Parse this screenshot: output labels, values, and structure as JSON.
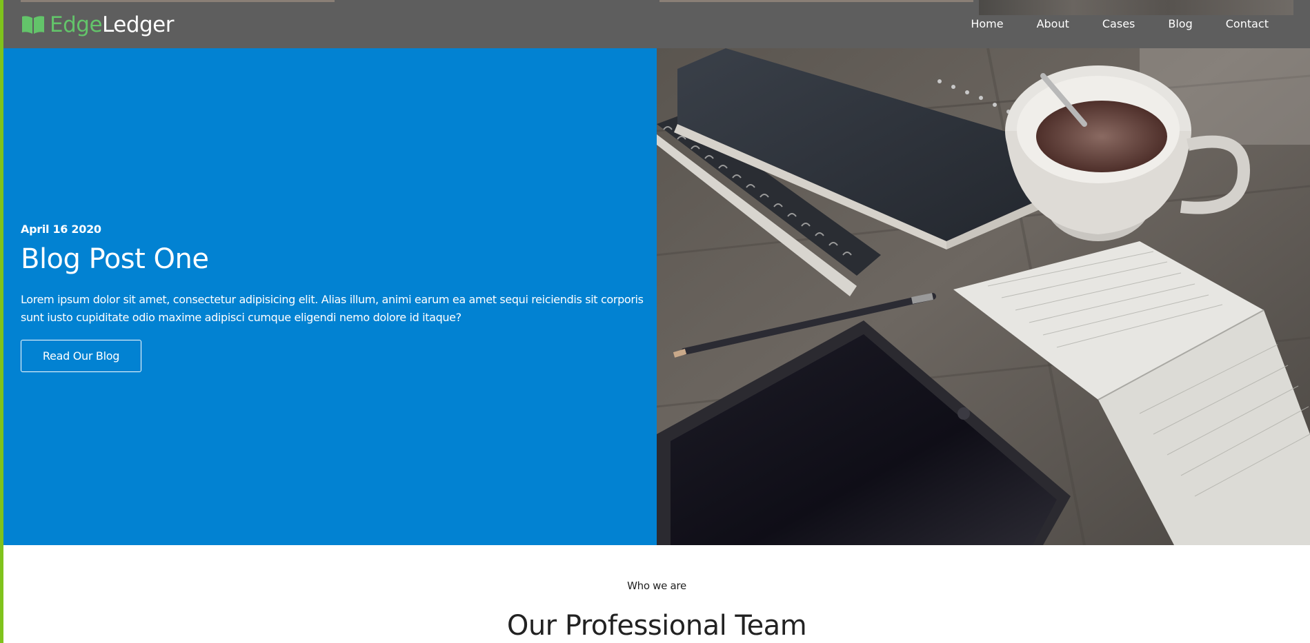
{
  "header": {
    "logo": {
      "part1": "Edge",
      "part2": "Ledger",
      "icon": "open-book-icon",
      "part1_color": "#63c46a",
      "part2_color": "#ffffff"
    },
    "nav": [
      {
        "label": "Home"
      },
      {
        "label": "About"
      },
      {
        "label": "Cases"
      },
      {
        "label": "Blog"
      },
      {
        "label": "Contact"
      }
    ],
    "background_color": "#5e5e5e"
  },
  "hero": {
    "date": "April 16 2020",
    "title": "Blog Post One",
    "body": "Lorem ipsum dolor sit amet, consectetur adipisicing elit. Alias illum, animi earum ea amet sequi reiciendis sit corporis sunt iusto cupiditate odio maxime adipisci cumque eligendi nemo dolore id itaque?",
    "button_label": "Read Our Blog",
    "background_color": "#0282d2",
    "image": "desk-notebooks-coffee-tablet-photo"
  },
  "team": {
    "kicker": "Who we are",
    "title": "Our Professional Team"
  },
  "colors": {
    "accent_stripe": "#7fc31c",
    "text_dark": "#222222"
  }
}
